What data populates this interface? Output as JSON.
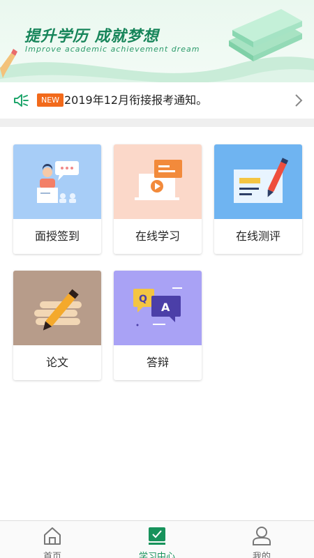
{
  "banner": {
    "title": "提升学历 成就梦想",
    "subtitle": "Improve academic achievement dream"
  },
  "notice": {
    "badge": "NEW",
    "text": "2019年12月衔接报考通知。",
    "icon": "speaker-icon"
  },
  "modules": [
    {
      "label": "面授签到",
      "icon": "classroom-teacher-icon",
      "color": "#a7cdf7"
    },
    {
      "label": "在线学习",
      "icon": "video-play-icon",
      "color": "#fbd8c9"
    },
    {
      "label": "在线测评",
      "icon": "pen-paper-icon",
      "color": "#6fb4f1"
    },
    {
      "label": "论文",
      "icon": "books-pencil-icon",
      "color": "#b79c8a"
    },
    {
      "label": "答辩",
      "icon": "qa-bubble-icon",
      "color": "#a9a2f5"
    }
  ],
  "tabs": [
    {
      "label": "首页",
      "icon": "home-icon",
      "active": false
    },
    {
      "label": "学习中心",
      "icon": "study-icon",
      "active": true
    },
    {
      "label": "我的",
      "icon": "user-icon",
      "active": false
    }
  ],
  "colors": {
    "brand_green": "#17925b",
    "new_badge": "#f26a1b"
  }
}
